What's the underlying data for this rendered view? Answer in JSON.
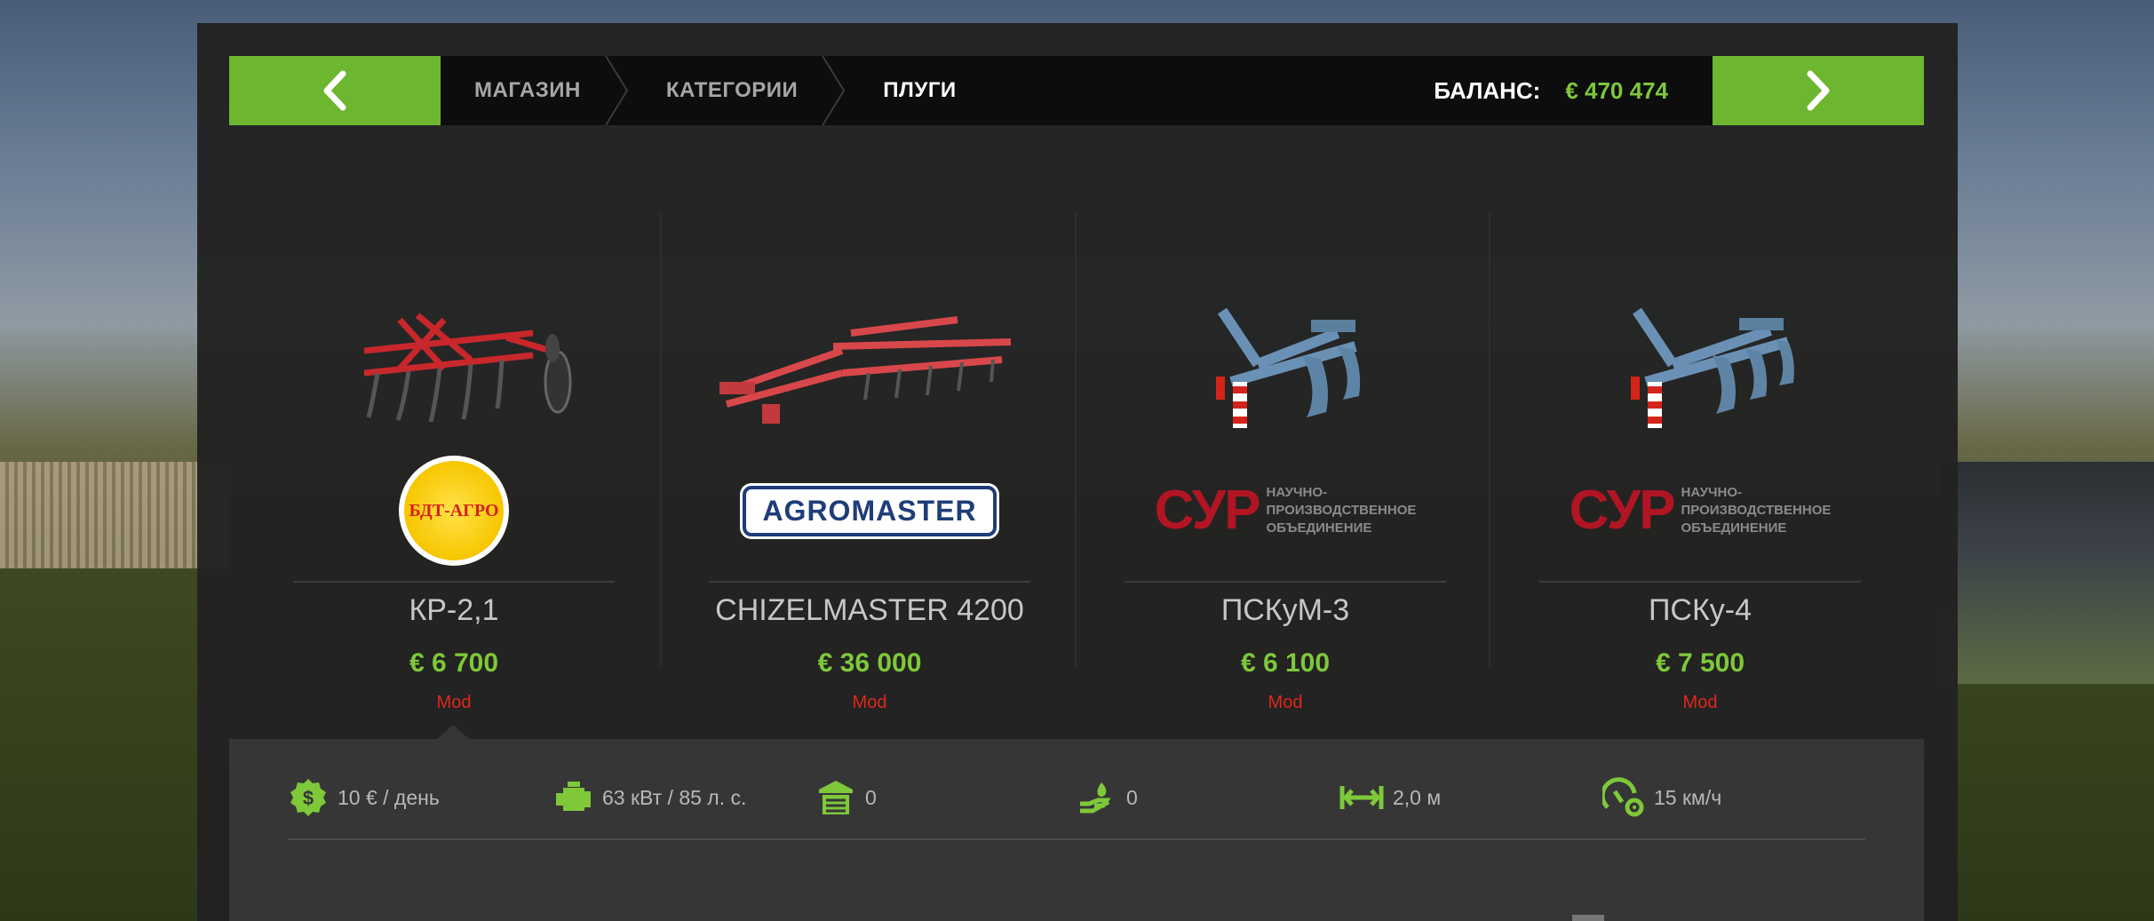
{
  "nav": {
    "breadcrumbs": [
      {
        "label": "МАГАЗИН"
      },
      {
        "label": "КАТЕГОРИИ"
      },
      {
        "label": "ПЛУГИ"
      }
    ],
    "balance_label": "БАЛАНС:",
    "balance_value": "€ 470 474"
  },
  "items": [
    {
      "name": "КР-2,1",
      "price": "€ 6 700",
      "tag": "Mod",
      "brand": "БДТ-АГРО",
      "image_icon": "red-cultivator",
      "selected": true
    },
    {
      "name": "CHIZELMASTER 4200",
      "price": "€ 36 000",
      "tag": "Mod",
      "brand": "AGROMASTER",
      "image_icon": "red-chisel-cultivator"
    },
    {
      "name": "ПСКуМ-3",
      "price": "€ 6 100",
      "tag": "Mod",
      "brand": "СУР",
      "brand_text": [
        "НАУЧНО-",
        "ПРОИЗВОДСТВЕННОЕ",
        "ОБЪЕДИНЕНИЕ"
      ],
      "image_icon": "blue-plow"
    },
    {
      "name": "ПСКу-4",
      "price": "€ 7 500",
      "tag": "Mod",
      "brand": "СУР",
      "brand_text": [
        "НАУЧНО-",
        "ПРОИЗВОДСТВЕННОЕ",
        "ОБЪЕДИНЕНИЕ"
      ],
      "image_icon": "blue-plow"
    }
  ],
  "specs": [
    {
      "icon": "cost-per-day-icon",
      "value": "10 € / день"
    },
    {
      "icon": "engine-power-icon",
      "value": "63 кВт / 85 л. с."
    },
    {
      "icon": "capacity-icon",
      "value": "0"
    },
    {
      "icon": "fill-hand-icon",
      "value": "0"
    },
    {
      "icon": "working-width-icon",
      "value": "2,0 м"
    },
    {
      "icon": "speed-limit-icon",
      "value": "15 км/ч"
    }
  ],
  "colors": {
    "accent": "#6cb72f",
    "price": "#7ec83a",
    "mod": "#e0271d"
  }
}
